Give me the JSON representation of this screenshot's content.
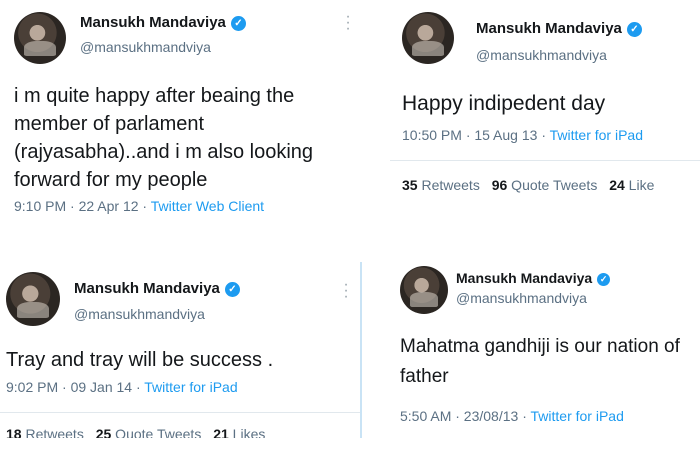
{
  "tweets": [
    {
      "name": "Mansukh Mandaviya",
      "handle": "@mansukhmandviya",
      "text": "i m quite happy after beaing the member of parlament (rajyasabha)..and i m also looking forward for my people",
      "time": "9:10 PM · 22 Apr 12 · ",
      "source": "Twitter Web Client",
      "verified_icon": "verified-badge"
    },
    {
      "name": "Mansukh Mandaviya",
      "handle": "@mansukhmandviya",
      "text": "Happy indipedent day",
      "time": "10:50 PM · 15 Aug 13 · ",
      "source": "Twitter for iPad",
      "retweets": "35",
      "retweets_label": " Retweets",
      "quotes": "96",
      "quotes_label": " Quote Tweets",
      "likes": "24",
      "likes_label": " Like"
    },
    {
      "name": "Mansukh Mandaviya",
      "handle": "@mansukhmandviya",
      "text": "Tray and tray will be success .",
      "time": "9:02 PM · 09 Jan 14 · ",
      "source": "Twitter for iPad",
      "retweets": "18",
      "retweets_label": " Retweets",
      "quotes": "25",
      "quotes_label": " Quote Tweets",
      "likes": "21",
      "likes_label": " Likes"
    },
    {
      "name": "Mansukh Mandaviya",
      "handle": "@mansukhmandviya",
      "text": "Mahatma gandhiji is our nation of father",
      "time": "5:50 AM · 23/08/13 · ",
      "source": "Twitter for iPad"
    }
  ],
  "colors": {
    "accent": "#1d9bf0",
    "muted": "#5b7083",
    "text": "#14171a"
  }
}
